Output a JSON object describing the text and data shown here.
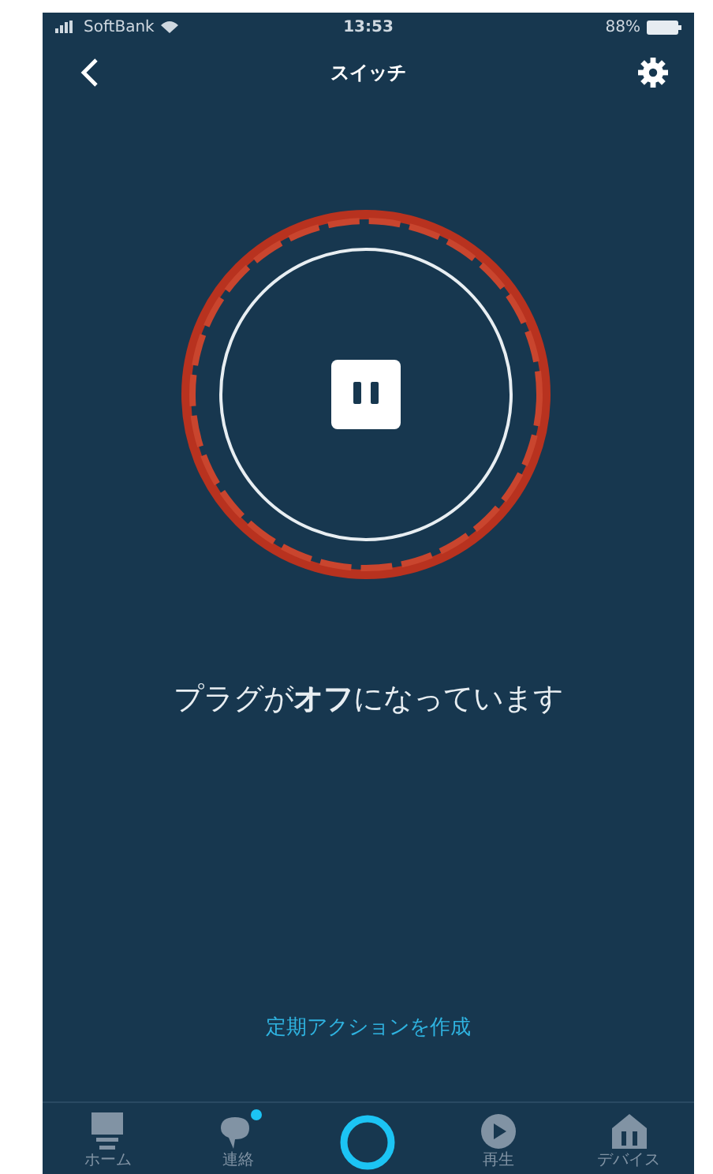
{
  "status_bar": {
    "carrier": "SoftBank",
    "time": "13:53",
    "battery": "88%"
  },
  "header": {
    "title": "スイッチ"
  },
  "plug": {
    "on": false
  },
  "message": "プラグが**オフ**になっています",
  "link": "定期アクションを作成",
  "nav": [
    {
      "kind": "home",
      "label": "ホーム",
      "badge": false
    },
    {
      "kind": "communicate",
      "label": "連絡",
      "badge": true
    },
    {
      "kind": "alexa"
    },
    {
      "kind": "play",
      "label": "再生",
      "badge": false
    },
    {
      "kind": "devices",
      "label": "デバイス",
      "badge": false
    }
  ]
}
